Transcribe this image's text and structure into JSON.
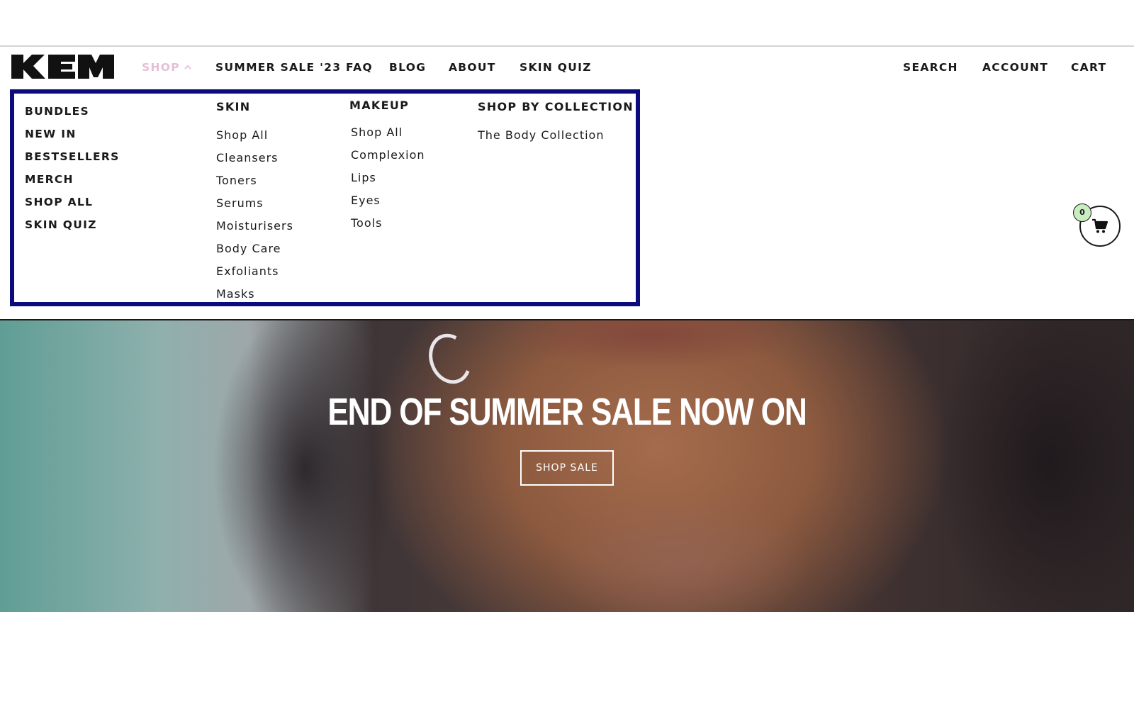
{
  "brand": {
    "logo_text": "KEM"
  },
  "header": {
    "nav": [
      "SHOP",
      "SUMMER SALE '23 FAQ",
      "BLOG",
      "ABOUT",
      "SKIN QUIZ"
    ],
    "utility": [
      "SEARCH",
      "ACCOUNT",
      "CART"
    ],
    "active_item": "SHOP"
  },
  "mega_menu": {
    "primary_links": [
      "BUNDLES",
      "NEW IN",
      "BESTSELLERS",
      "MERCH",
      "SHOP ALL",
      "SKIN QUIZ"
    ],
    "columns": [
      {
        "heading": "SKIN",
        "links": [
          "Shop All",
          "Cleansers",
          "Toners",
          "Serums",
          "Moisturisers",
          "Body Care",
          "Exfoliants",
          "Masks"
        ]
      },
      {
        "heading": "MAKEUP",
        "links": [
          "Shop All",
          "Complexion",
          "Lips",
          "Eyes",
          "Tools"
        ]
      },
      {
        "heading": "SHOP BY COLLECTION",
        "links": [
          "The Body Collection"
        ]
      }
    ],
    "border_color": "#0b0b7e"
  },
  "floating_cart": {
    "count": "0",
    "icon": "cart-icon",
    "badge_color": "#c9ecc1"
  },
  "hero": {
    "title": "END OF SUMMER SALE NOW ON",
    "button_label": "SHOP SALE"
  },
  "colors": {
    "active_nav": "#e3bfd6",
    "text": "#1a1a1a"
  }
}
